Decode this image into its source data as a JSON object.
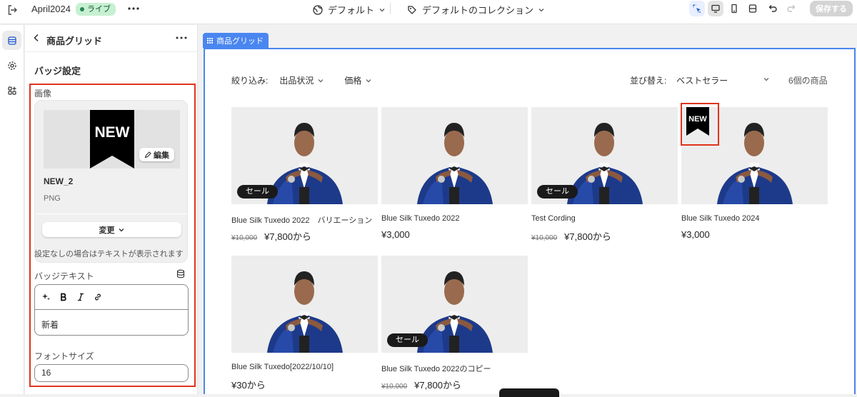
{
  "topbar": {
    "theme_name": "April2024",
    "live_badge": "ライブ",
    "template_dropdown": "デフォルト",
    "collection_dropdown": "デフォルトのコレクション",
    "save_label": "保存する"
  },
  "panel": {
    "title": "商品グリッド",
    "section_title": "バッジ設定",
    "image_label": "画像",
    "image_preview_text": "NEW",
    "edit_label": "編集",
    "image_name": "NEW_2",
    "image_type": "PNG",
    "change_label": "変更",
    "hint": "設定なしの場合はテキストが表示されます",
    "badge_text_label": "バッジテキスト",
    "badge_text_value": "新着",
    "font_size_label": "フォントサイズ",
    "font_size_value": "16"
  },
  "preview": {
    "section_tag": "商品グリッド",
    "filter_label": "絞り込み:",
    "filters": [
      "出品状況",
      "価格"
    ],
    "sort_label": "並び替え:",
    "sort_value": "ベストセラー",
    "product_count": "6個の商品",
    "new_badge_text": "NEW",
    "products": [
      {
        "name": "Blue Silk Tuxedo 2022　バリエーション",
        "compare": "¥10,000",
        "price": "¥7,800から",
        "badge": "セール"
      },
      {
        "name": "Blue Silk Tuxedo 2022",
        "compare": "",
        "price": "¥3,000",
        "badge": ""
      },
      {
        "name": "Test Cording",
        "compare": "¥10,000",
        "price": "¥7,800から",
        "badge": "セール"
      },
      {
        "name": "Blue Silk Tuxedo 2024",
        "compare": "",
        "price": "¥3,000",
        "badge": ""
      },
      {
        "name": "Blue Silk Tuxedo[2022/10/10]",
        "compare": "",
        "price": "¥30から",
        "badge": ""
      },
      {
        "name": "Blue Silk Tuxedo 2022のコピー",
        "compare": "¥10,000",
        "price": "¥7,800から",
        "badge": "セール"
      }
    ]
  }
}
